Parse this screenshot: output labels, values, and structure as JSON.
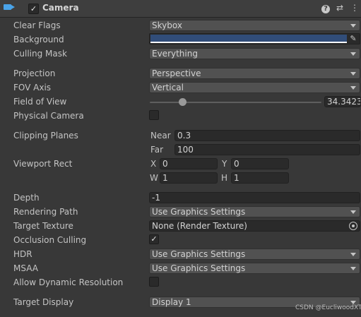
{
  "header": {
    "title": "Camera",
    "enabled_mark": "✓",
    "help_glyph": "?",
    "preset_glyph": "⇄",
    "more_glyph": "⋮"
  },
  "fields": {
    "clear_flags": {
      "label": "Clear Flags",
      "value": "Skybox"
    },
    "background": {
      "label": "Background",
      "color": "#314d79"
    },
    "culling_mask": {
      "label": "Culling Mask",
      "value": "Everything"
    },
    "projection": {
      "label": "Projection",
      "value": "Perspective"
    },
    "fov_axis": {
      "label": "FOV Axis",
      "value": "Vertical"
    },
    "field_of_view": {
      "label": "Field of View",
      "value": "34.3423",
      "slider_fraction": 0.19
    },
    "physical_camera": {
      "label": "Physical Camera",
      "checked": false
    },
    "clipping_planes": {
      "label": "Clipping Planes",
      "near_label": "Near",
      "near": "0.3",
      "far_label": "Far",
      "far": "100"
    },
    "viewport_rect": {
      "label": "Viewport Rect",
      "x_label": "X",
      "x": "0",
      "y_label": "Y",
      "y": "0",
      "w_label": "W",
      "w": "1",
      "h_label": "H",
      "h": "1"
    },
    "depth": {
      "label": "Depth",
      "value": "-1"
    },
    "rendering_path": {
      "label": "Rendering Path",
      "value": "Use Graphics Settings"
    },
    "target_texture": {
      "label": "Target Texture",
      "value": "None (Render Texture)"
    },
    "occlusion_culling": {
      "label": "Occlusion Culling",
      "checked": true,
      "mark": "✓"
    },
    "hdr": {
      "label": "HDR",
      "value": "Use Graphics Settings"
    },
    "msaa": {
      "label": "MSAA",
      "value": "Use Graphics Settings"
    },
    "allow_dynamic_resolution": {
      "label": "Allow Dynamic Resolution",
      "checked": false
    },
    "target_display": {
      "label": "Target Display",
      "value": "Display 1"
    }
  },
  "watermark": "CSDN @EucliwoodXT",
  "colors": {
    "accent_icon": "#4aa3e8",
    "panel": "#383838",
    "header": "#3e3e3e"
  }
}
